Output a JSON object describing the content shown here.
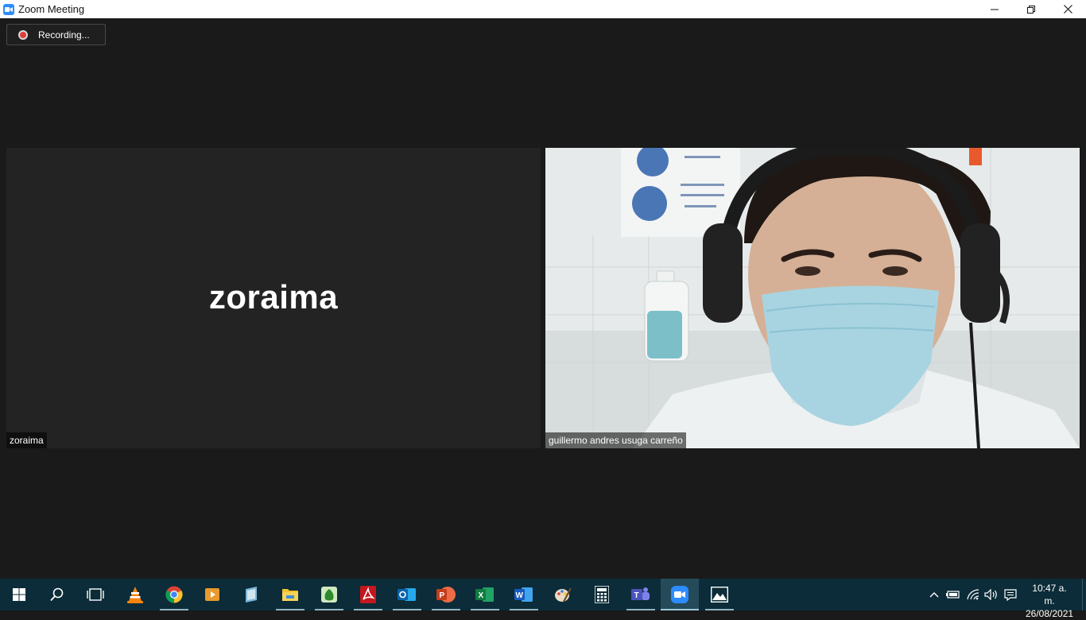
{
  "window": {
    "title": "Zoom Meeting",
    "controls": [
      "minimize-icon",
      "restore-icon",
      "close-icon"
    ]
  },
  "meeting": {
    "recording_label": "Recording...",
    "participants": [
      {
        "display_name": "zoraima",
        "name_tag": "zoraima",
        "video_on": false
      },
      {
        "display_name": "guillermo andres usuga carreño",
        "name_tag": "guillermo andres usuga carreño",
        "video_on": true
      }
    ]
  },
  "taskbar": {
    "apps": [
      {
        "icon": "windows-start-icon",
        "running": false
      },
      {
        "icon": "search-icon",
        "running": false
      },
      {
        "icon": "task-view-icon",
        "running": false
      },
      {
        "icon": "vlc-icon",
        "running": false
      },
      {
        "icon": "chrome-icon",
        "running": true
      },
      {
        "icon": "media-player-icon",
        "running": false
      },
      {
        "icon": "notebook-app-icon",
        "running": false
      },
      {
        "icon": "file-explorer-icon",
        "running": true
      },
      {
        "icon": "green-app-icon",
        "running": true
      },
      {
        "icon": "acrobat-icon",
        "running": true
      },
      {
        "icon": "outlook-icon",
        "running": true
      },
      {
        "icon": "powerpoint-icon",
        "running": true
      },
      {
        "icon": "excel-icon",
        "running": true
      },
      {
        "icon": "word-icon",
        "running": true
      },
      {
        "icon": "paint-icon",
        "running": false
      },
      {
        "icon": "calculator-icon",
        "running": false
      },
      {
        "icon": "teams-icon",
        "running": true
      },
      {
        "icon": "zoom-icon",
        "running": true,
        "active": true
      },
      {
        "icon": "photos-icon",
        "running": true
      }
    ],
    "tray": [
      "chevron-up-icon",
      "battery-icon",
      "wifi-icon",
      "volume-icon",
      "notifications-icon"
    ],
    "clock": {
      "time": "10:47 a. m.",
      "date": "26/08/2021"
    }
  },
  "colors": {
    "window_bg": "#1a1a1a",
    "taskbar_bg": "#0b2c38",
    "zoom_blue": "#2d8cff",
    "recording_red": "#e03a3a"
  }
}
